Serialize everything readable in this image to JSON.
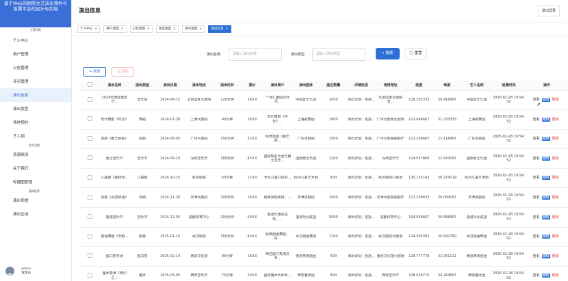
{
  "sidebar": {
    "brand_title": "基于Web的剧院文艺演出预约与售票平台的设计与实现",
    "menu_caption": "主要功能",
    "items": [
      {
        "label": "个人中心"
      },
      {
        "label": "用户管理"
      },
      {
        "label": "公告管理"
      },
      {
        "label": "评论管理"
      },
      {
        "label": "演出信息",
        "active": true
      },
      {
        "label": "演出类型"
      },
      {
        "label": "场地预约"
      },
      {
        "label": "艺人调",
        "sub": "举办设置"
      },
      {
        "label": "资源修改"
      },
      {
        "label": "关于我们"
      },
      {
        "label": "轮播图管理",
        "sub": "通知推荐"
      },
      {
        "label": "演出场馆"
      },
      {
        "label": "演出区域"
      }
    ],
    "user": {
      "name": "admin",
      "role": "管理员"
    }
  },
  "header": {
    "title": "演出信息",
    "logout_label": "退出登录"
  },
  "tabs": [
    {
      "label": "个人中心",
      "active": false
    },
    {
      "label": "用户管理",
      "active": false
    },
    {
      "label": "公告管理",
      "active": false
    },
    {
      "label": "演出类型",
      "active": false
    },
    {
      "label": "评论管理",
      "active": false
    },
    {
      "label": "演出信息",
      "active": true
    }
  ],
  "search": {
    "name_label": "演出名称",
    "name_placeholder": "请输入演出名称",
    "type_label": "演出类型",
    "type_placeholder": "请输入演出类型",
    "search_label": "搜索",
    "reset_label": "重置"
  },
  "actions": {
    "add_label": "+ 新增",
    "delete_label": "删除"
  },
  "table": {
    "columns": [
      "演出名称",
      "演出类型",
      "演出日期",
      "演出地点",
      "演出时长",
      "票价",
      "演出简介",
      "演出团体",
      "座位数量",
      "详细信息",
      "场馆地址",
      "经度",
      "纬度",
      "艺人名称",
      "创建时间",
      "操作"
    ],
    "row_ops": {
      "view": "查看",
      "edit": "编辑",
      "delete": "删除"
    },
    "rows": [
      [
        "2024年度经典音乐...",
        "音乐会",
        "2024-06-15",
        "北京国家大剧院",
        "120分钟",
        "380.0",
        "一场汇聚国内外顶...",
        "中国爱乐乐团",
        "2000",
        "演出详情：包括...",
        "北京国家大剧院音...",
        "116.303333",
        "39.916667",
        "中国爱乐乐团",
        "2026-02-28 19:54:52"
      ],
      [
        "现代舞剧《时光》",
        "舞蹈",
        "2024-07-20",
        "上海大剧院",
        "90分钟",
        "280.0",
        "现代舞剧《时光》...",
        "上海歌舞团",
        "1800",
        "演出详情：包括...",
        "广州大剧院大剧场",
        "121.466667",
        "31.233333",
        "上海歌舞团",
        "2026-02-28 19:54:52"
      ],
      [
        "京剧《霸王别姬》",
        "京剧",
        "2024-08-05",
        "广州大剧院",
        "150分钟",
        "220.0",
        "经典京剧《霸王别...",
        "广东京剧院",
        "1500",
        "演出详情：包括...",
        "广州大剧院歌剧厅",
        "113.266667",
        "23.116667",
        "广东京剧院",
        "2026-02-28 19:54:52"
      ],
      [
        "爵士音乐节",
        "音乐节",
        "2024-09-10",
        "深圳音乐厅",
        "180分钟",
        "450.0",
        "国际知名乐团与爵士音乐...",
        "国际爵士乐团",
        "1200",
        "演出详情：包括...",
        "深圳音乐厅",
        "114.057868",
        "22.543097",
        "国际爵士乐团",
        "2026-02-28 19:54:52"
      ],
      [
        "儿童剧《森林奇...",
        "儿童剧",
        "2024-10-15",
        "杭州剧院",
        "60分钟",
        "120.0",
        "专为儿童打造的...",
        "杭州儿童艺术剧",
        "800",
        "演出详情：包括...",
        "杭州剧院小剧场",
        "120.155143",
        "30.274119",
        "杭州儿童艺术剧",
        "2026-02-28 19:54:52"
      ],
      [
        "京剧《贵妃醉酒》",
        "戏曲",
        "2024-11-20",
        "天津大剧院",
        "100分钟",
        "180.0",
        "经典京剧曲目，...",
        "天津京剧院",
        "1000",
        "演出详情：包括...",
        "天津大剧院歌剧厅",
        "117.200833",
        "39.084167",
        "天津京剧院",
        "2026-02-28 19:54:52"
      ],
      [
        "摇滚音乐节",
        "音乐节",
        "2024-12-05",
        "成都体育中心",
        "200分钟",
        "500.0",
        "摇滚乐迷的狂欢，...",
        "摇滚乐队联盟",
        "5000",
        "演出详情：包括...",
        "成都体育中心",
        "104.066667",
        "30.666667",
        "摇滚乐队联盟",
        "2026-02-28 19:54:52"
      ],
      [
        "芭蕾舞剧《天鹅...",
        "芭蕾",
        "2025-01-10",
        "武汉剧院",
        "160分钟",
        "400.0",
        "经典芭蕾舞剧，由...",
        "武汉芭蕾舞团",
        "1200",
        "演出详情：包括...",
        "武汉剧院大剧场",
        "114.305393",
        "30.592760",
        "武汉芭蕾舞团",
        "2026-02-28 19:54:52"
      ],
      [
        "脱口秀专场",
        "脱口秀",
        "2025-02-14",
        "南京文化馆",
        "90分钟",
        "180.0",
        "知名脱口秀演员专...",
        "南京笑果剧团",
        "600",
        "演出详情：包括...",
        "南京文化馆小剧场",
        "118.777778",
        "32.061111",
        "南京笑果剧团",
        "2026-02-28 19:54:52"
      ],
      [
        "魔术表演《奇幻之...",
        "魔术",
        "2025-03-05",
        "西安音乐厅",
        "75分钟",
        "200.0",
        "国际魔术大师专...",
        "西安魔术团",
        "800",
        "演出详情：包括...",
        "西安音乐厅",
        "108.939770",
        "34.264667",
        "西安魔术团",
        "2026-02-28 19:54:52"
      ]
    ]
  }
}
